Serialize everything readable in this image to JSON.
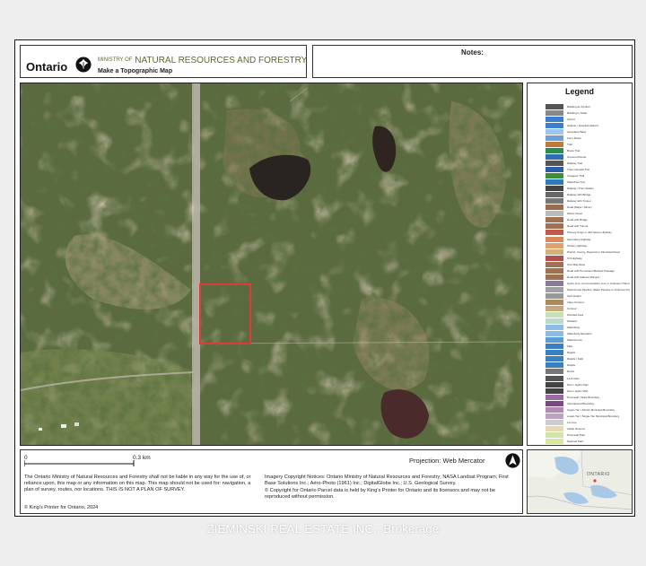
{
  "header": {
    "ontario_word": "Ontario",
    "ministry_prefix": "MINISTRY OF",
    "ministry_name": "NATURAL RESOURCES AND FORESTRY",
    "map_title": "Make a Topographic Map",
    "ministry_color": "#5a6b2a"
  },
  "notes": {
    "label": "Notes:"
  },
  "legend": {
    "title": "Legend",
    "items": [
      {
        "label": "Building as Symbol",
        "color": "#555555"
      },
      {
        "label": "Building to Scale",
        "color": "#888888"
      },
      {
        "label": "Airport",
        "color": "#3a7fd0"
      },
      {
        "label": "Heliport / Hospital Heliport",
        "color": "#3a7fd0"
      },
      {
        "label": "Aeroplane Base",
        "color": "#9ec4e8"
      },
      {
        "label": "Ferry Route",
        "color": "#6fa0d8"
      },
      {
        "label": "Trail",
        "color": "#c07a3a"
      },
      {
        "label": "Bruce Trail",
        "color": "#2f8c4a"
      },
      {
        "label": "Groomed Route",
        "color": "#2f6fb0"
      },
      {
        "label": "Railway Trail",
        "color": "#555555"
      },
      {
        "label": "Trans Canada Trail",
        "color": "#2a5fa5"
      },
      {
        "label": "Voyageur Trail",
        "color": "#3b8f3b"
      },
      {
        "label": "Waterfront Trail",
        "color": "#2b7bbf"
      },
      {
        "label": "Railway / Train Station",
        "color": "#444444"
      },
      {
        "label": "Railway with Bridge",
        "color": "#666666"
      },
      {
        "label": "Railway with Tunnel",
        "color": "#777777"
      },
      {
        "label": "Road (Major / Minor)",
        "color": "#9b6b4b"
      },
      {
        "label": "Winter Road",
        "color": "#bbbbbb"
      },
      {
        "label": "Road with Bridge",
        "color": "#a07050"
      },
      {
        "label": "Road with Tunnel",
        "color": "#a07050"
      },
      {
        "label": "Primary Kings or 400-Series Highway",
        "color": "#c25a4a"
      },
      {
        "label": "Secondary Highway",
        "color": "#d98a5a"
      },
      {
        "label": "Tertiary Highway",
        "color": "#e0a070"
      },
      {
        "label": "District, County, Regional or Municipal Road",
        "color": "#d4b07a"
      },
      {
        "label": "Toll Highway",
        "color": "#b05050"
      },
      {
        "label": "One Way Road",
        "color": "#a07050"
      },
      {
        "label": "Road with Permanent Blocked Passage",
        "color": "#a07050"
      },
      {
        "label": "Road with Address Ranges",
        "color": "#a07050"
      },
      {
        "label": "Hydro Line, Communication Line or Unknown Transmission Line",
        "color": "#8a7a9a"
      },
      {
        "label": "Natural Gas Pipeline, Water Pipeline or Unknown Pipeline",
        "color": "#a0a0a0"
      },
      {
        "label": "Spot Height",
        "color": "#999999"
      },
      {
        "label": "Index Contour",
        "color": "#b08a5a"
      },
      {
        "label": "Contour",
        "color": "#c8a878"
      },
      {
        "label": "Wooded Area",
        "color": "#c9dfb6"
      },
      {
        "label": "Wetland",
        "color": "#b9d9c9"
      },
      {
        "label": "Waterbody",
        "color": "#8cbce6"
      },
      {
        "label": "Waterbody Elevation",
        "color": "#8cbce6"
      },
      {
        "label": "Watercourse",
        "color": "#5a9ed8"
      },
      {
        "label": "Falls",
        "color": "#3a7fc0"
      },
      {
        "label": "Rapids",
        "color": "#3a7fc0"
      },
      {
        "label": "Rapids / Falls",
        "color": "#3a7fc0"
      },
      {
        "label": "Rapids",
        "color": "#3a7fc0"
      },
      {
        "label": "Rocks",
        "color": "#777777"
      },
      {
        "label": "Lock Gate",
        "color": "#555555"
      },
      {
        "label": "Dam / Hydro Dam",
        "color": "#444444"
      },
      {
        "label": "Dam / Hydro Wall",
        "color": "#444444"
      },
      {
        "label": "Provincial / State Boundary",
        "color": "#9a6aa0"
      },
      {
        "label": "International Boundary",
        "color": "#7a4a80"
      },
      {
        "label": "Upper-Tier / District Municipal Boundary",
        "color": "#b08ab0"
      },
      {
        "label": "Lower-Tier / Single-Tier Municipal Boundary",
        "color": "#c0a0c0"
      },
      {
        "label": "Lot Line",
        "color": "#cccccc"
      },
      {
        "label": "Indian Reserve",
        "color": "#e8d8b0"
      },
      {
        "label": "Provincial Park",
        "color": "#cfe4a8"
      },
      {
        "label": "National Park",
        "color": "#d8e8a0"
      },
      {
        "label": "Conservation Reserve",
        "color": "#d8ecc8"
      },
      {
        "label": "Military Lands",
        "color": "#f0c0c0"
      }
    ]
  },
  "scale": {
    "start": "0",
    "end": "0.3",
    "unit": "km"
  },
  "projection": "Projection: Web Mercator",
  "disclaimer": "The Ontario Ministry of Natural Resources and Forestry shall not be liable in any way for the use of, or reliance upon, this map or any information on this map.  This map should not be used for: navigation, a plan of survey, routes, nor locations. THIS IS NOT A PLAN OF SURVEY.",
  "kings_printer": "© King's Printer for Ontario,  2024",
  "imagery_notice": "Imagery Copyright Notices: Ontario Ministry of Natural Resources and Forestry; NASA Landsat Program; First Base Solutions Inc.; Aéro-Photo (1961) Inc.; DigitalGlobe Inc.; U.S. Geological Survey.",
  "parcel_notice": "© Copyright for Ontario Parcel data is held by King's Printer for Ontario and its licensors and may not be reproduced without permission.",
  "minimap": {
    "label": "ONTARIO"
  },
  "watermark": "ZIEMINSKI REAL ESTATE INC., Brokerage",
  "colors": {
    "parcel_outline": "#e03a3a",
    "road": "#b8b4a8"
  }
}
